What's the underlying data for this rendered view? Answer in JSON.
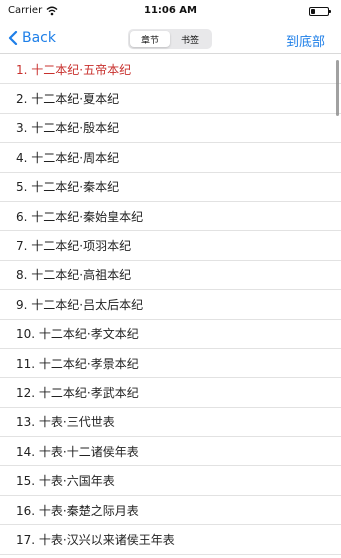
{
  "status_bar": {
    "carrier": "Carrier",
    "time": "11:06 AM",
    "wifi_icon": "wifi-icon",
    "battery_icon": "battery-icon"
  },
  "nav": {
    "back_label": "Back",
    "back_icon": "chevron-left-icon",
    "segments": [
      "章节",
      "书签"
    ],
    "selected_segment": "章节",
    "right_link": "到底部",
    "accent_color": "#1e7fe8"
  },
  "chapters": {
    "current_index": 0,
    "current_color": "#c8302d",
    "items": [
      "1. 十二本纪·五帝本纪",
      "2. 十二本纪·夏本纪",
      "3. 十二本纪·殷本纪",
      "4. 十二本纪·周本纪",
      "5. 十二本纪·秦本纪",
      "6. 十二本纪·秦始皇本纪",
      "7. 十二本纪·项羽本纪",
      "8. 十二本纪·高祖本纪",
      "9. 十二本纪·吕太后本纪",
      "10. 十二本纪·孝文本纪",
      "11. 十二本纪·孝景本纪",
      "12. 十二本纪·孝武本纪",
      "13. 十表·三代世表",
      "14. 十表·十二诸侯年表",
      "15. 十表·六国年表",
      "16. 十表·秦楚之际月表",
      "17. 十表·汉兴以来诸侯王年表"
    ]
  }
}
